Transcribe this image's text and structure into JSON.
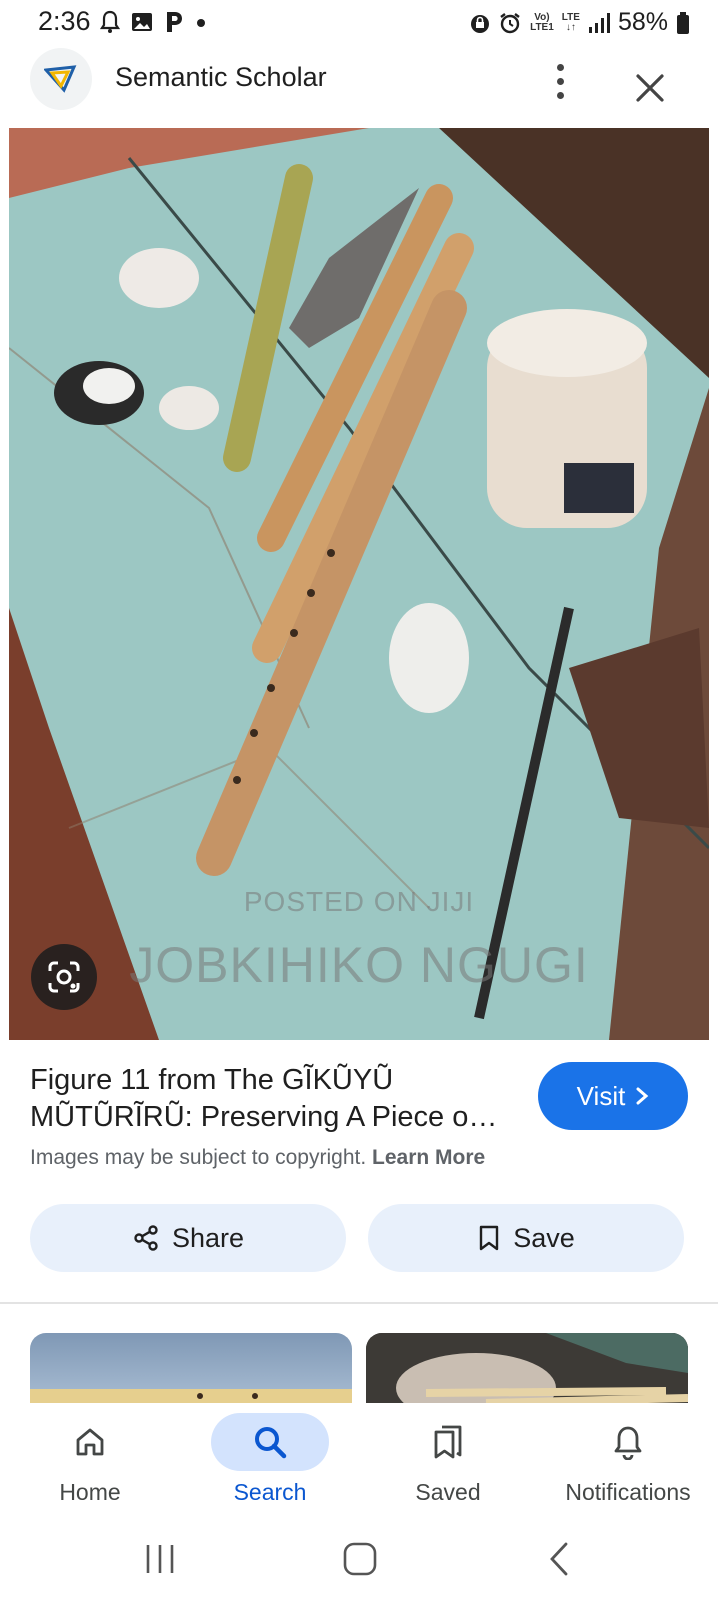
{
  "status_bar": {
    "time": "2:36",
    "left_icons": [
      "bell-icon",
      "image-icon",
      "p-icon",
      "dot-icon"
    ],
    "network_label_top": "Vo)",
    "network_label_bottom": "LTE1",
    "lte_label": "LTE",
    "battery": "58%"
  },
  "header": {
    "site_name": "Semantic Scholar"
  },
  "image": {
    "watermark_line1": "POSTED ON JIJI",
    "watermark_line2": "JOBKIHIKO NGUGI",
    "colors": {
      "board": "#9cc7c3",
      "wall": "#b96b55",
      "wood": "#c9955f"
    }
  },
  "result": {
    "title": "Figure 11 from The GĨKŨYŨ MŨTŨRĨRŨ: Preserving A Piece o…",
    "visit_label": "Visit",
    "copyright_text": "Images may be subject to copyright.",
    "learn_more_label": "Learn More"
  },
  "actions": {
    "share_label": "Share",
    "save_label": "Save"
  },
  "bottom_nav": {
    "items": [
      {
        "label": "Home",
        "icon": "home-icon"
      },
      {
        "label": "Search",
        "icon": "search-icon",
        "active": true
      },
      {
        "label": "Saved",
        "icon": "bookmarks-icon"
      },
      {
        "label": "Notifications",
        "icon": "bell-icon"
      }
    ]
  },
  "colors": {
    "accent": "#1a73e8",
    "active_nav": "#0b57d0",
    "action_bg": "#e8f0fb"
  }
}
